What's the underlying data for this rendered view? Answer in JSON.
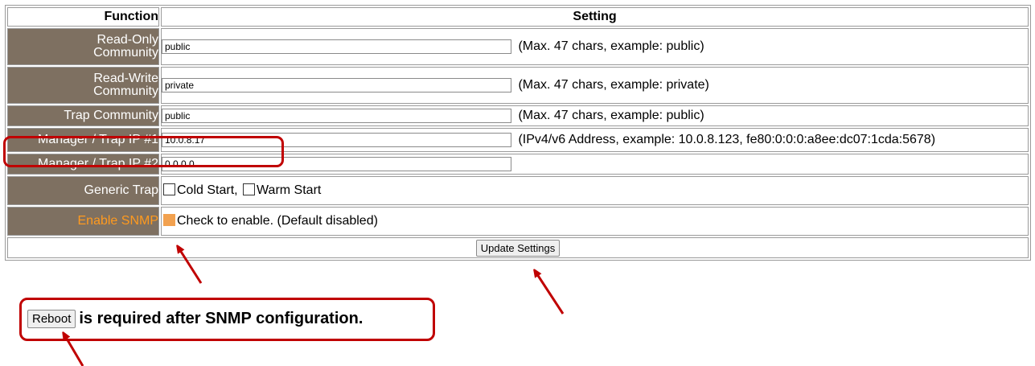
{
  "table": {
    "header_function": "Function",
    "header_setting": "Setting",
    "rows": {
      "ro_community": {
        "label_line1": "Read-Only",
        "label_line2": "Community",
        "value": "public",
        "hint": "(Max. 47 chars, example: public)"
      },
      "rw_community": {
        "label_line1": "Read-Write",
        "label_line2": "Community",
        "value": "private",
        "hint": "(Max. 47 chars, example: private)"
      },
      "trap_community": {
        "label": "Trap Community",
        "value": "public",
        "hint": "(Max. 47 chars, example: public)"
      },
      "manager_ip1": {
        "label": "Manager / Trap IP #1",
        "value": "10.0.8.17",
        "hint": "(IPv4/v6 Address, example: 10.0.8.123, fe80:0:0:0:a8ee:dc07:1cda:5678)"
      },
      "manager_ip2": {
        "label": "Manager / Trap IP #2",
        "value": "0.0.0.0"
      },
      "generic_trap": {
        "label": "Generic Trap",
        "cold_start": "Cold Start,",
        "warm_start": "Warm Start",
        "cold_checked": false,
        "warm_checked": false
      },
      "enable_snmp": {
        "label": "Enable SNMP",
        "text": "Check to enable. (Default disabled)",
        "checked": true
      }
    },
    "update_button": "Update Settings"
  },
  "reboot": {
    "button": "Reboot",
    "text": "is required after SNMP configuration."
  },
  "colors": {
    "label_bg": "#7e7061",
    "label_text": "#ffffff",
    "snmp_label_text": "#ff9a1f",
    "highlight": "#c00000",
    "checkbox_checked": "#f2a14f"
  }
}
